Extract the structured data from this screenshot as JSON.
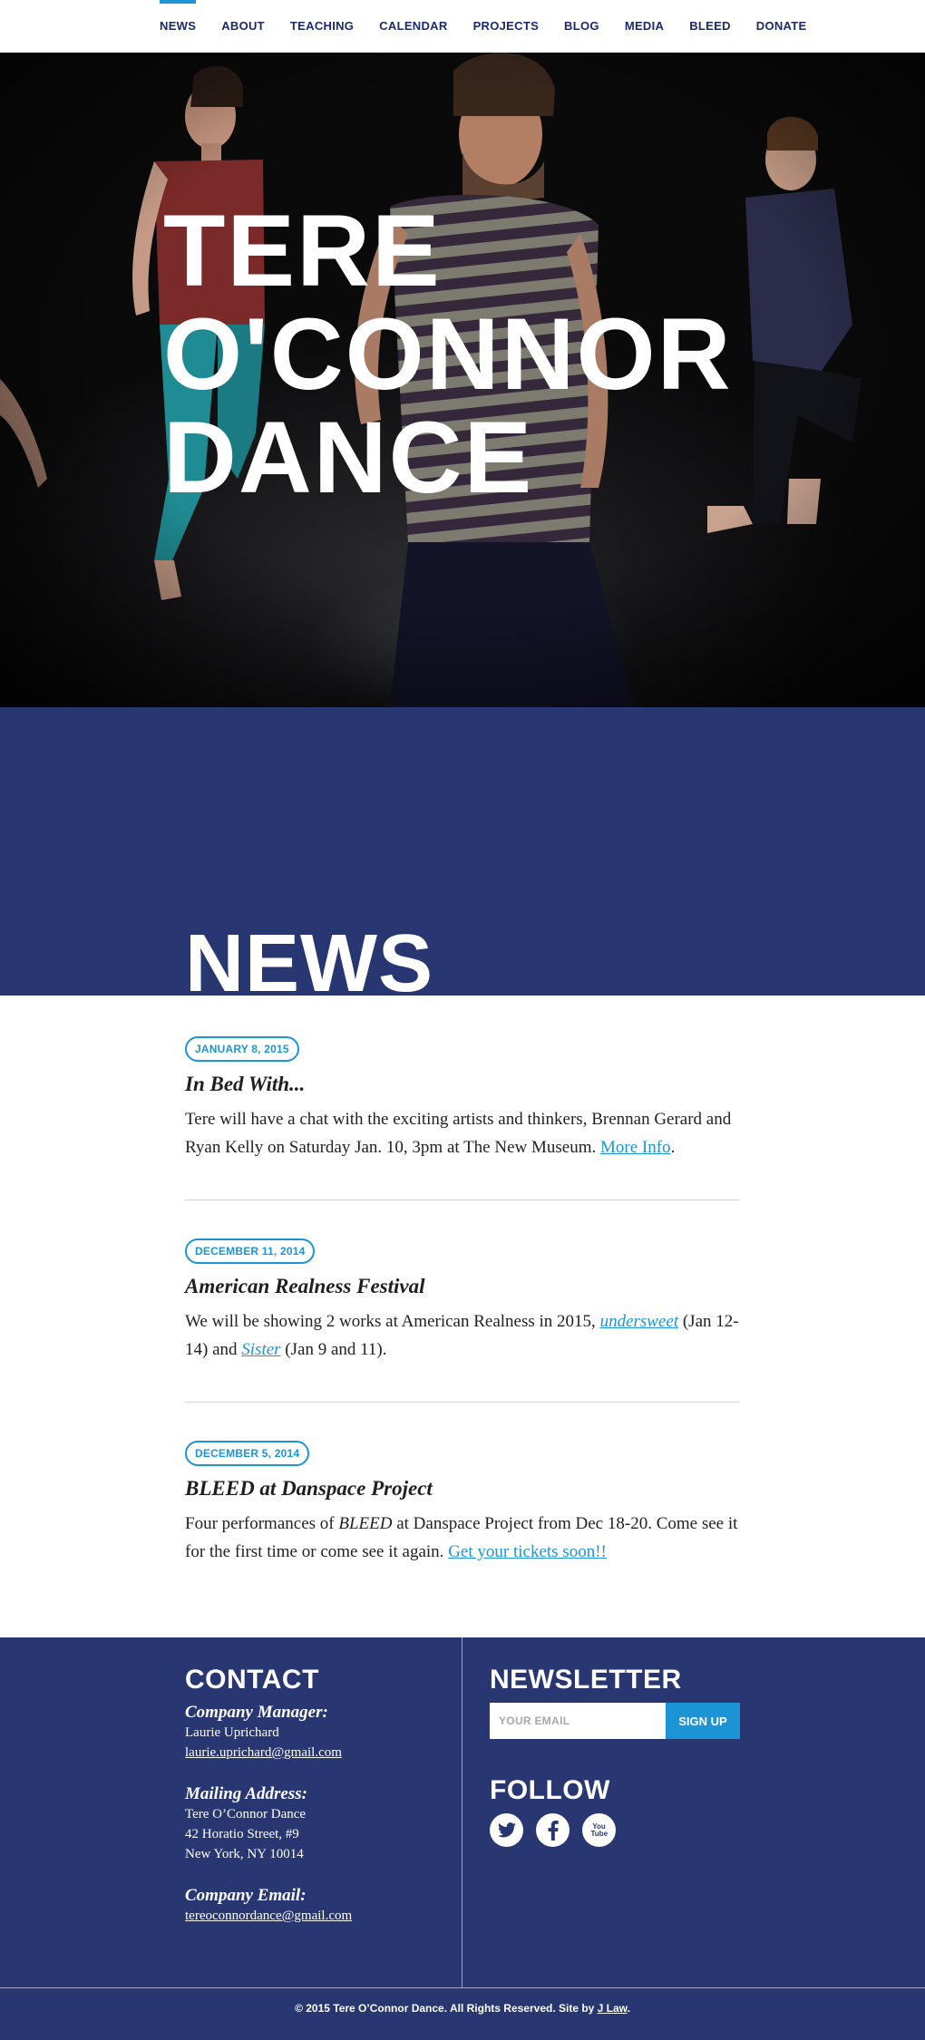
{
  "nav": {
    "items": [
      {
        "label": "NEWS",
        "active": true
      },
      {
        "label": "ABOUT"
      },
      {
        "label": "TEACHING"
      },
      {
        "label": "CALENDAR"
      },
      {
        "label": "PROJECTS"
      },
      {
        "label": "BLOG"
      },
      {
        "label": "MEDIA"
      },
      {
        "label": "BLEED"
      },
      {
        "label": "DONATE"
      }
    ],
    "active_color": "#1b95d6",
    "text_color": "#1c2a6b"
  },
  "hero": {
    "title_lines": [
      "TERE",
      "O'CONNOR",
      "DANCE"
    ]
  },
  "news": {
    "heading": "NEWS",
    "posts": [
      {
        "date": "JANUARY 8, 2015",
        "title": "In Bed With...",
        "body_1": "Tere will have a chat with the exciting artists and thinkers, Brennan Gerard and Ryan Kelly on Saturday Jan. 10, 3pm at The New Museum. ",
        "link": "More Info",
        "body_2": "."
      },
      {
        "date": "DECEMBER 11, 2014",
        "title": "American Realness Festival",
        "body_1": "We will be showing 2 works at American Realness in 2015, ",
        "link_1": "undersweet",
        "body_2": " (Jan 12-14) and ",
        "link_2": "Sister",
        "body_3": " (Jan 9 and 11)."
      },
      {
        "date": "DECEMBER 5, 2014",
        "title": "BLEED at Danspace Project",
        "body_1": "Four performances of ",
        "emph": "BLEED",
        "body_2": " at Danspace Project from Dec 18-20. Come see it for the first time or come see it again. ",
        "link": "Get your tickets soon!!"
      }
    ]
  },
  "footer": {
    "contact": {
      "heading": "CONTACT",
      "manager_label": "Company Manager:",
      "manager_name": "Laurie Uprichard",
      "manager_email": "laurie.uprichard@gmail.com",
      "address_label": "Mailing Address:",
      "address_1": "Tere O’Connor Dance",
      "address_2": "42 Horatio Street, #9",
      "address_3": "New York, NY 10014",
      "email_label": "Company Email:",
      "email": "tereoconnordance@gmail.com"
    },
    "newsletter": {
      "heading": "NEWSLETTER",
      "placeholder": "YOUR EMAIL",
      "button": "SIGN UP"
    },
    "follow": {
      "heading": "FOLLOW",
      "icons": [
        "twitter-icon",
        "facebook-icon",
        "youtube-icon"
      ],
      "youtube_text": "You Tube"
    },
    "copyright": "© 2015 Tere O’Connor Dance. All Rights Reserved. Site by ",
    "credit_link": "J Law",
    "copyright_end": "."
  },
  "colors": {
    "band": "#283772",
    "accent": "#1b95d6"
  }
}
